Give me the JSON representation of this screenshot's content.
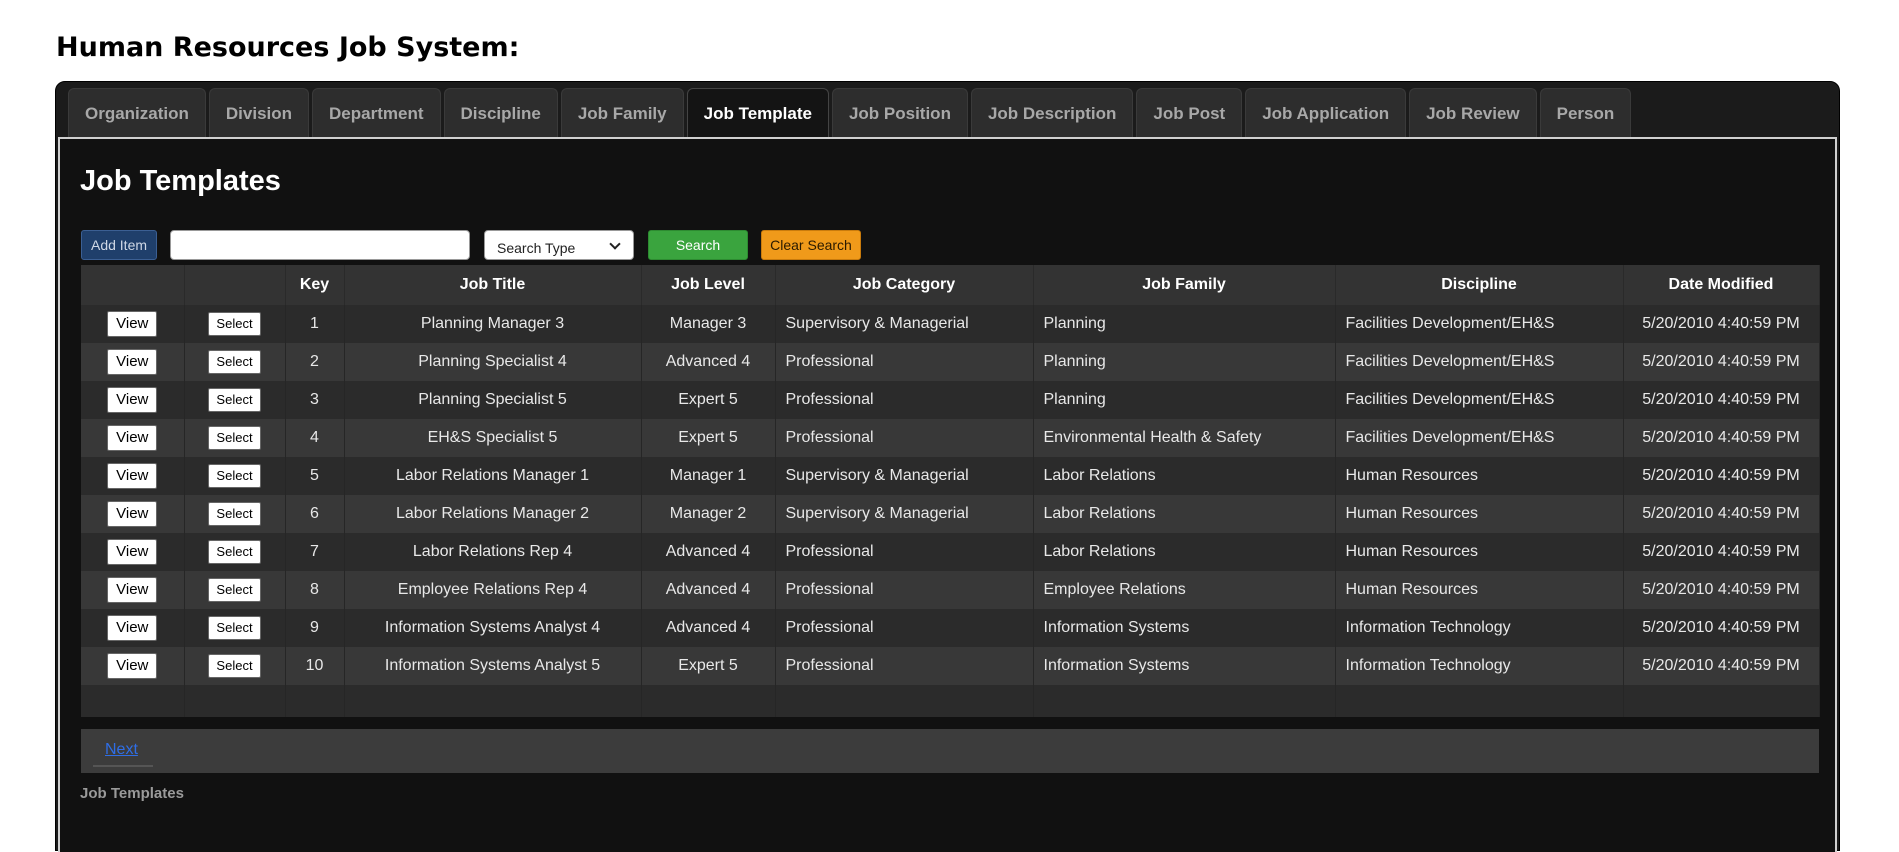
{
  "app": {
    "title": "Human Resources Job System:"
  },
  "tabs": [
    {
      "label": "Organization",
      "active": false
    },
    {
      "label": "Division",
      "active": false
    },
    {
      "label": "Department",
      "active": false
    },
    {
      "label": "Discipline",
      "active": false
    },
    {
      "label": "Job Family",
      "active": false
    },
    {
      "label": "Job Template",
      "active": true
    },
    {
      "label": "Job Position",
      "active": false
    },
    {
      "label": "Job Description",
      "active": false
    },
    {
      "label": "Job Post",
      "active": false
    },
    {
      "label": "Job Application",
      "active": false
    },
    {
      "label": "Job Review",
      "active": false
    },
    {
      "label": "Person",
      "active": false
    }
  ],
  "panel": {
    "title": "Job Templates",
    "footer_label": "Job Templates"
  },
  "toolbar": {
    "add_label": "Add Item",
    "search_value": "",
    "search_placeholder": "",
    "search_type_label": "Search Type",
    "search_label": "Search",
    "clear_label": "Clear Search"
  },
  "table": {
    "view_label": "View",
    "select_label": "Select",
    "columns": [
      "",
      "",
      "Key",
      "Job Title",
      "Job Level",
      "Job Category",
      "Job Family",
      "Discipline",
      "Date Modified"
    ],
    "rows": [
      {
        "key": "1",
        "title": "Planning Manager 3",
        "level": "Manager 3",
        "category": "Supervisory & Managerial",
        "family": "Planning",
        "discipline": "Facilities Development/EH&S",
        "modified": "5/20/2010 4:40:59 PM"
      },
      {
        "key": "2",
        "title": "Planning Specialist 4",
        "level": "Advanced 4",
        "category": "Professional",
        "family": "Planning",
        "discipline": "Facilities Development/EH&S",
        "modified": "5/20/2010 4:40:59 PM"
      },
      {
        "key": "3",
        "title": "Planning Specialist 5",
        "level": "Expert 5",
        "category": "Professional",
        "family": "Planning",
        "discipline": "Facilities Development/EH&S",
        "modified": "5/20/2010 4:40:59 PM"
      },
      {
        "key": "4",
        "title": "EH&S Specialist 5",
        "level": "Expert 5",
        "category": "Professional",
        "family": "Environmental Health & Safety",
        "discipline": "Facilities Development/EH&S",
        "modified": "5/20/2010 4:40:59 PM"
      },
      {
        "key": "5",
        "title": "Labor Relations Manager 1",
        "level": "Manager 1",
        "category": "Supervisory & Managerial",
        "family": "Labor Relations",
        "discipline": "Human Resources",
        "modified": "5/20/2010 4:40:59 PM"
      },
      {
        "key": "6",
        "title": "Labor Relations Manager 2",
        "level": "Manager 2",
        "category": "Supervisory & Managerial",
        "family": "Labor Relations",
        "discipline": "Human Resources",
        "modified": "5/20/2010 4:40:59 PM"
      },
      {
        "key": "7",
        "title": "Labor Relations Rep 4",
        "level": "Advanced 4",
        "category": "Professional",
        "family": "Labor Relations",
        "discipline": "Human Resources",
        "modified": "5/20/2010 4:40:59 PM"
      },
      {
        "key": "8",
        "title": "Employee Relations Rep 4",
        "level": "Advanced 4",
        "category": "Professional",
        "family": "Employee Relations",
        "discipline": "Human Resources",
        "modified": "5/20/2010 4:40:59 PM"
      },
      {
        "key": "9",
        "title": "Information Systems Analyst 4",
        "level": "Advanced 4",
        "category": "Professional",
        "family": "Information Systems",
        "discipline": "Information Technology",
        "modified": "5/20/2010 4:40:59 PM"
      },
      {
        "key": "10",
        "title": "Information Systems Analyst 5",
        "level": "Expert 5",
        "category": "Professional",
        "family": "Information Systems",
        "discipline": "Information Technology",
        "modified": "5/20/2010 4:40:59 PM"
      }
    ]
  },
  "pager": {
    "next_label": "Next"
  }
}
